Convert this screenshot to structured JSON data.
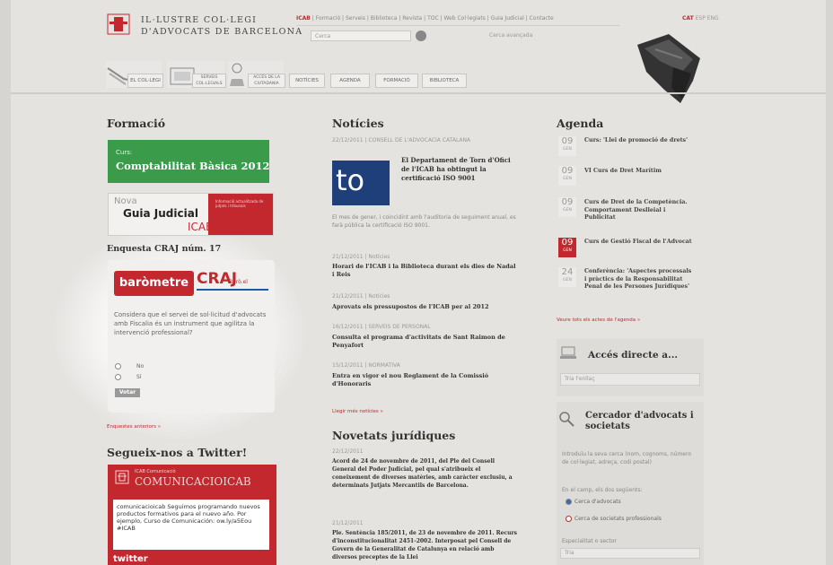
{
  "header": {
    "logo_line1": "IL·LUSTRE COL·LEGI",
    "logo_line2": "D'ADVOCATS DE BARCELONA",
    "toplinks_active": "ICAB",
    "toplinks_rest": "| Formació | Serveis | Biblioteca | Revista | TOC | Web Col·legiats | Guia Judicial | Contacte",
    "lang_active": "CAT",
    "lang_rest": "ESP ENG",
    "search_placeholder": "Cerca",
    "search_advanced": "Cerca avançada"
  },
  "nav": {
    "tabs": [
      "EL COL·LEGI",
      "SERVEIS COL·LEGIALS",
      "ACCÉS DE LA CIUTADANIA",
      "NOTÍCIES",
      "AGENDA",
      "FORMACIÓ",
      "BIBLIOTECA"
    ]
  },
  "left": {
    "formacio_title": "Formació",
    "banner_curs": "Curs:",
    "banner_title": "Comptabilitat Bàsica 2012",
    "guia_nova": "Nova",
    "guia_title": "Guia Judicial",
    "guia_icab": "ICAB",
    "guia_red_text": "Informació actualitzada de jutjats i tribunals",
    "enquesta_title": "Enquesta CRAJ núm. 17",
    "barometre": "baròmetre",
    "craj": "CRAJ",
    "craj_sub": "Barò.el",
    "poll_question": "Considera que el servei de sol·licitud d'advocats amb Fiscalia és un instrument que agilitza la intervenció professional?",
    "opt_no": "No",
    "opt_si": "Sí",
    "votar": "Votar",
    "enquestes_anteriors": "Enquestes anteriors »",
    "twitter_title": "Segueix-nos a Twitter!",
    "tw_small": "ICAB Comunicació",
    "tw_head": "COMUNICACIOICAB",
    "tw_text": "comunicacioicab Seguimos programando nuevos productos formativos para el nuevo año. Por ejemplo, Curso de Comunicación: ow.ly/a5Eou #ICAB",
    "tw_logo": "twitter"
  },
  "middle": {
    "noticies_title": "Notícies",
    "news": [
      {
        "date": "22/12/2011 | CONSELL DE L'ADVOCACIA CATALANA",
        "title": "El Departament de Torn d'Ofici de l'ICAB ha obtingut la certificació ISO 9001",
        "text": "El mes de gener, i coincidint amb l'auditoria de seguiment anual, es farà pública la certificació ISO 9001."
      },
      {
        "date": "21/12/2011 | Notícies",
        "title": "Horari de l'ICAB i la Biblioteca durant els dies de Nadal i Reis"
      },
      {
        "date": "21/12/2011 | Notícies",
        "title": "Aprovats els pressupostos de l'ICAB per al 2012"
      },
      {
        "date": "16/12/2011 | SERVEIS DE PERSONAL",
        "title": "Consulta el programa d'activitats de Sant Raimon de Penyafort"
      },
      {
        "date": "15/12/2011 | NORMATIVA",
        "title": "Entra en vigor el nou Reglament de la Comissió d'Honoraris"
      }
    ],
    "mes_noticies": "Llegir més notícies »",
    "novetats_title": "Novetats jurídiques",
    "novetats": [
      {
        "date": "22/12/2011",
        "text": "Acord de 24 de novembre de 2011, del Ple del Consell General del Poder Judicial, pel qual s'atribueix el coneixement de diverses matèries, amb caràcter exclusiu, a determinats Jutjats Mercantils de Barcelona."
      },
      {
        "date": "21/12/2011",
        "text": "Ple. Sentència 185/2011, de 23 de novembre de 2011. Recurs d'inconstitucionalitat 2451-2002. Interposat pel Consell de Govern de la Generalitat de Catalunya en relació amb diversos preceptes de la Llei"
      }
    ],
    "news_img_text": "to"
  },
  "right": {
    "agenda_title": "Agenda",
    "events": [
      {
        "day": "09",
        "month": "GEN",
        "text": "Curs: 'Llei de promoció de drets'",
        "red": false
      },
      {
        "day": "09",
        "month": "GEN",
        "text": "VI Curs de Dret Marítim",
        "red": false
      },
      {
        "day": "09",
        "month": "GEN",
        "text": "Curs de Dret de la Competència. Comportament Deslleial i Publicitat",
        "red": false
      },
      {
        "day": "09",
        "month": "GEN",
        "text": "Curs de Gestió Fiscal de l'Advocat",
        "red": true
      },
      {
        "day": "24",
        "month": "GEN",
        "text": "Conferència: 'Aspectes processals i pràctics de la Responsabilitat Penal de les Persones Jurídiques'",
        "red": false
      }
    ],
    "mes_agenda": "Veure tots els actes de l'agenda »",
    "acces_title": "Accés directe a...",
    "acces_select": "Tria l'enllaç",
    "cercador_title": "Cercador d'advocats i societats",
    "cercador_text": "Introduïu la seva cerca (nom, cognoms, número de col·legiat, adreça, codi postal)",
    "cercador_sub": "En el camp, els dos següents:",
    "opt_advocat": "Cerca d'advocats",
    "opt_societat": "Cerca de societats professionals",
    "especialitat_label": "Especialitat o sector",
    "cercador_input": "Tria"
  },
  "colors": {
    "accent_red": "#c2282e",
    "green": "#3a9b4a",
    "blue": "#1f3f7a"
  }
}
